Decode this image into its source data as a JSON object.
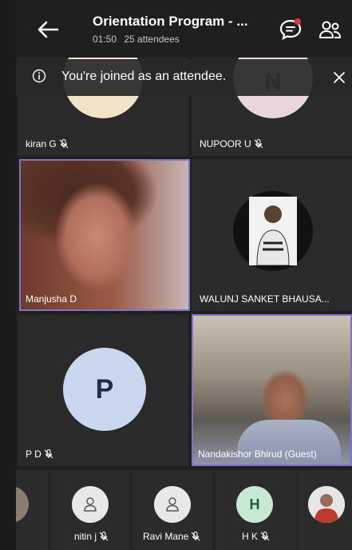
{
  "header": {
    "title": "Orientation Program - ...",
    "duration": "01:50",
    "attendees": "25 attendees"
  },
  "banner": {
    "text": "You're joined as an attendee."
  },
  "tiles": {
    "kiran": {
      "name": "kiran G"
    },
    "nupoor": {
      "name": "NUPOOR U",
      "initial": "N"
    },
    "manjusha": {
      "name": "Manjusha D"
    },
    "walunj": {
      "name": "WALUNJ SANKET BHAUSA..."
    },
    "pd": {
      "name": "P D",
      "initial": "P"
    },
    "nandakishor": {
      "name": "Nandakishor Bhirud (Guest)"
    }
  },
  "strip": {
    "items": [
      {
        "name": ""
      },
      {
        "name": "nitin j"
      },
      {
        "name": "Ravi Mane"
      },
      {
        "name": "H K",
        "initial": "H"
      },
      {
        "name": ""
      }
    ]
  },
  "colors": {
    "background": "#1f1f1f",
    "tile": "#2a2a2a",
    "active_speaker_border": "#7b74c9",
    "chat_badge": "#e0333a",
    "avatar_light_blue": "#c9d8ee",
    "avatar_green": "#c7e8d2"
  },
  "icons": {
    "back": "arrow-left-icon",
    "chat": "chat-bubble-icon",
    "people": "people-icon",
    "info": "info-icon",
    "close": "close-icon",
    "mic_off": "mic-off-icon"
  }
}
